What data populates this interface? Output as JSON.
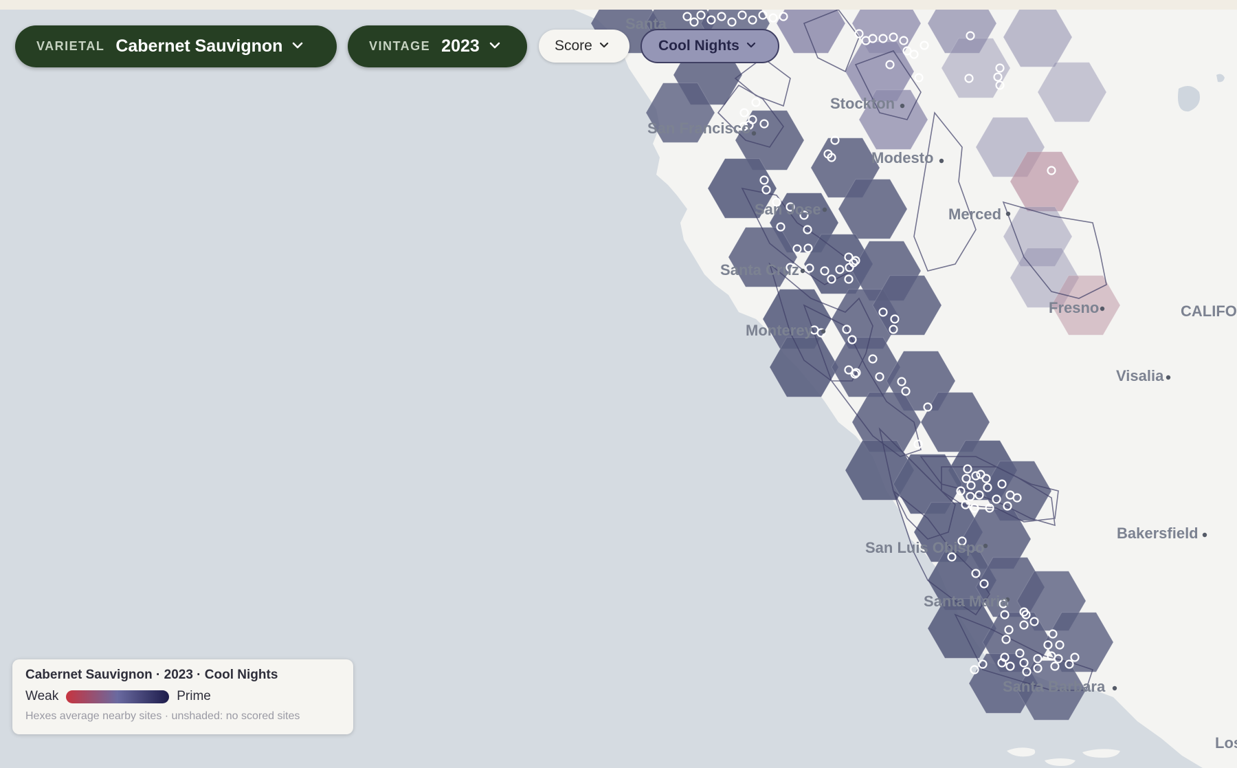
{
  "filters": {
    "varietal": {
      "label": "VARIETAL",
      "value": "Cabernet Sauvignon"
    },
    "vintage": {
      "label": "VINTAGE",
      "value": "2023"
    },
    "mode": {
      "value": "Score"
    },
    "metric": {
      "value": "Cool Nights"
    }
  },
  "map": {
    "cities": [
      "Santa",
      "Stockton",
      "San Francisco",
      "Modesto",
      "San Jose",
      "Merced",
      "Santa Cruz",
      "Fresno",
      "Monterey",
      "CALIFO",
      "Visalia",
      "Bakersfield",
      "San Luis Obispo",
      "Santa Maria",
      "Santa Barbara",
      "Los"
    ],
    "colors": {
      "ocean": "#d5dbe1",
      "land": "#f4f4f2",
      "hex_prime": "#5a5f80",
      "hex_mid": "#8c8aab",
      "hex_weak": "#b98f9f",
      "site_marker": "#ffffff"
    }
  },
  "legend": {
    "title": "Cabernet Sauvignon · 2023 · Cool Nights",
    "weak": "Weak",
    "prime": "Prime",
    "note": "Hexes average nearby sites · unshaded: no scored sites",
    "gradient": [
      "#c7343f",
      "#6a6aa0",
      "#1d1c4b"
    ]
  }
}
